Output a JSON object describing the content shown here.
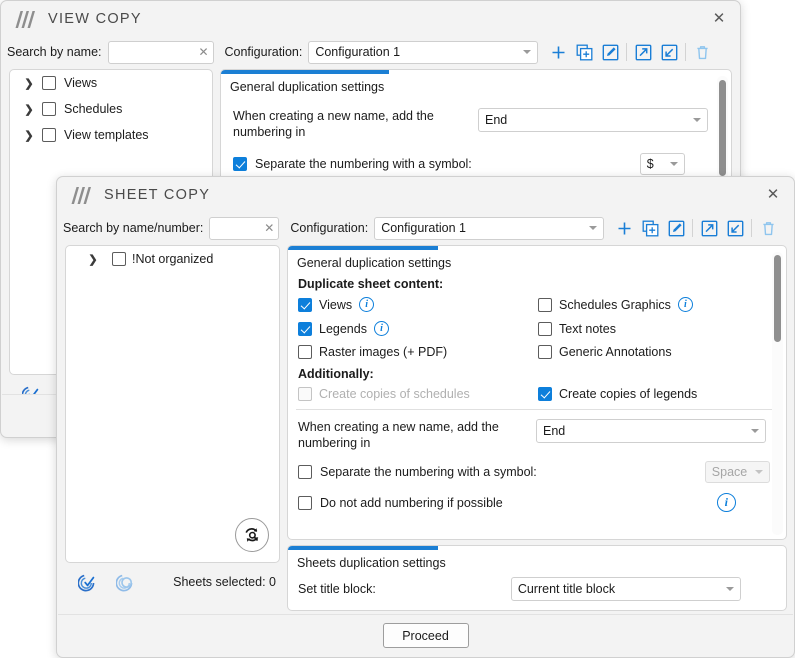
{
  "windows": {
    "view_copy": {
      "title": "VIEW COPY",
      "logo_icon": "logo-triple-slash-icon",
      "close_icon": "close-icon",
      "search": {
        "label": "Search by name:",
        "value": "",
        "placeholder": "",
        "clear_icon": "clear-icon"
      },
      "configuration": {
        "label": "Configuration:",
        "value": "Configuration 1"
      },
      "toolbar_buttons": [
        {
          "name": "add-configuration-button",
          "icon": "plus-icon"
        },
        {
          "name": "duplicate-configuration-button",
          "icon": "copy-plus-icon"
        },
        {
          "name": "rename-configuration-button",
          "icon": "edit-pencil-icon"
        },
        {
          "name": "export-configuration-button",
          "icon": "export-arrow-icon"
        },
        {
          "name": "import-configuration-button",
          "icon": "import-arrow-icon"
        },
        {
          "name": "delete-configuration-button",
          "icon": "trash-icon"
        }
      ],
      "tree": [
        {
          "label": "Views",
          "checked": false,
          "expanded": false
        },
        {
          "label": "Schedules",
          "checked": false,
          "expanded": false
        },
        {
          "label": "View templates",
          "checked": false,
          "expanded": false
        }
      ],
      "section": {
        "title": "General duplication settings"
      },
      "numbering_label": "When creating a new name, add the numbering in",
      "numbering_value": "End",
      "separate_symbol": {
        "label": "Separate the numbering with a symbol:",
        "checked": true,
        "value": "$"
      },
      "status_icons": [
        {
          "name": "select-all-icon"
        },
        {
          "name": "deselect-all-icon"
        }
      ]
    },
    "sheet_copy": {
      "title": "SHEET COPY",
      "logo_icon": "logo-triple-slash-icon",
      "close_icon": "close-icon",
      "search": {
        "label": "Search by name/number:",
        "value": "",
        "placeholder": "",
        "clear_icon": "clear-icon"
      },
      "configuration": {
        "label": "Configuration:",
        "value": "Configuration 1"
      },
      "toolbar_buttons": [
        {
          "name": "add-configuration-button",
          "icon": "plus-icon"
        },
        {
          "name": "duplicate-configuration-button",
          "icon": "copy-plus-icon"
        },
        {
          "name": "rename-configuration-button",
          "icon": "edit-pencil-icon"
        },
        {
          "name": "export-configuration-button",
          "icon": "export-arrow-icon"
        },
        {
          "name": "import-configuration-button",
          "icon": "import-arrow-icon"
        },
        {
          "name": "delete-configuration-button",
          "icon": "trash-icon"
        }
      ],
      "tree": [
        {
          "label": "!Not organized",
          "checked": false,
          "expanded": false
        }
      ],
      "refresh_button": {
        "icon": "refresh-search-icon"
      },
      "status_icons": [
        {
          "name": "select-all-icon"
        },
        {
          "name": "deselect-all-icon"
        }
      ],
      "sheets_selected": "Sheets selected: 0",
      "section_general": {
        "title": "General duplication settings",
        "content_header": "Duplicate sheet content:",
        "content_left": [
          {
            "label": "Views",
            "checked": true,
            "info": true,
            "disabled": false
          },
          {
            "label": "Legends",
            "checked": true,
            "info": true,
            "disabled": false
          },
          {
            "label": "Raster images (+ PDF)",
            "checked": false,
            "info": false,
            "disabled": false
          }
        ],
        "content_right": [
          {
            "label": "Schedules Graphics",
            "checked": false,
            "info": true,
            "disabled": false
          },
          {
            "label": "Text notes",
            "checked": false,
            "info": false,
            "disabled": false
          },
          {
            "label": "Generic Annotations",
            "checked": false,
            "info": false,
            "disabled": false
          }
        ],
        "additionally_header": "Additionally:",
        "additionally_left": [
          {
            "label": "Create copies of schedules",
            "checked": false,
            "info": false,
            "disabled": true
          }
        ],
        "additionally_right": [
          {
            "label": "Create copies of legends",
            "checked": true,
            "info": false,
            "disabled": false
          }
        ],
        "numbering_label": "When creating a new name, add the numbering in",
        "numbering_value": "End",
        "separate_symbol": {
          "label": "Separate the numbering with a symbol:",
          "checked": false,
          "value": "Space",
          "disabled": true
        },
        "no_numbering": {
          "label": "Do not add numbering if possible",
          "checked": false,
          "info": true
        }
      },
      "section_sheets": {
        "title": "Sheets duplication settings",
        "title_block_label": "Set title block:",
        "title_block_value": "Current title block"
      },
      "proceed_label": "Proceed"
    }
  },
  "colors": {
    "accent": "#1b7fd4",
    "checkbox_checked": "#0d7fdb",
    "icon_blue": "#1a7ed6",
    "icon_blue_light": "#8fc5ee",
    "window_bg": "#f3f3f3",
    "panel_bg": "#ffffff"
  }
}
